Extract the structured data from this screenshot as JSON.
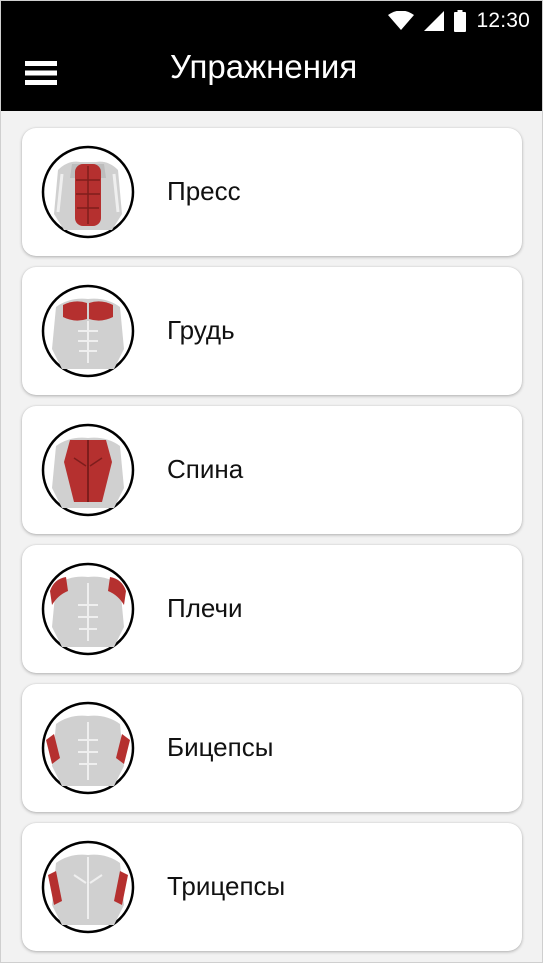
{
  "status_bar": {
    "time": "12:30",
    "icons": [
      "wifi-icon",
      "cell-signal-icon",
      "battery-icon"
    ]
  },
  "app_bar": {
    "title": "Упражнения",
    "menu_icon": "hamburger-menu-icon"
  },
  "colors": {
    "bar_background": "#000000",
    "muscle_highlight": "#b5302f",
    "figure_gray": "#cfcfcf",
    "list_background": "#f2f2f2"
  },
  "exercises": [
    {
      "label": "Пресс",
      "icon": "abs-muscle-icon"
    },
    {
      "label": "Грудь",
      "icon": "chest-muscle-icon"
    },
    {
      "label": "Спина",
      "icon": "back-muscle-icon"
    },
    {
      "label": "Плечи",
      "icon": "shoulders-muscle-icon"
    },
    {
      "label": "Бицепсы",
      "icon": "biceps-muscle-icon"
    },
    {
      "label": "Трицепсы",
      "icon": "triceps-muscle-icon"
    }
  ]
}
